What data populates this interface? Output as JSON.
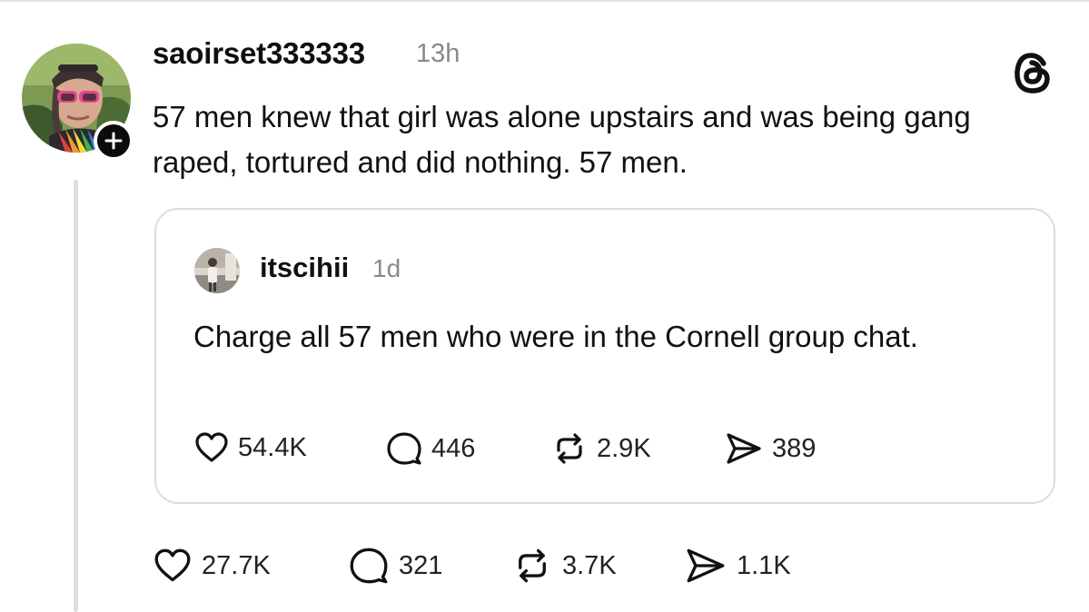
{
  "post": {
    "username": "saoirset333333",
    "time": "13h",
    "text": "57 men knew that girl was alone upstairs and was being gang raped, tortured and did nothing. 57 men.",
    "stats": {
      "likes": "27.7K",
      "replies": "321",
      "reposts": "3.7K",
      "shares": "1.1K"
    }
  },
  "quoted_post": {
    "username": "itscihii",
    "time": "1d",
    "text": "Charge all 57 men who were in the Cornell group chat.",
    "stats": {
      "likes": "54.4K",
      "replies": "446",
      "reposts": "2.9K",
      "shares": "389"
    }
  },
  "icons": {
    "logo": "threads-logo-icon",
    "follow": "plus-icon",
    "like": "heart-icon",
    "reply": "comment-bubble-icon",
    "repost": "repost-icon",
    "share": "send-icon"
  },
  "colors": {
    "text": "#111111",
    "muted": "#8a8a8a",
    "border": "#dcdcdc",
    "thread_line": "#dedede"
  }
}
